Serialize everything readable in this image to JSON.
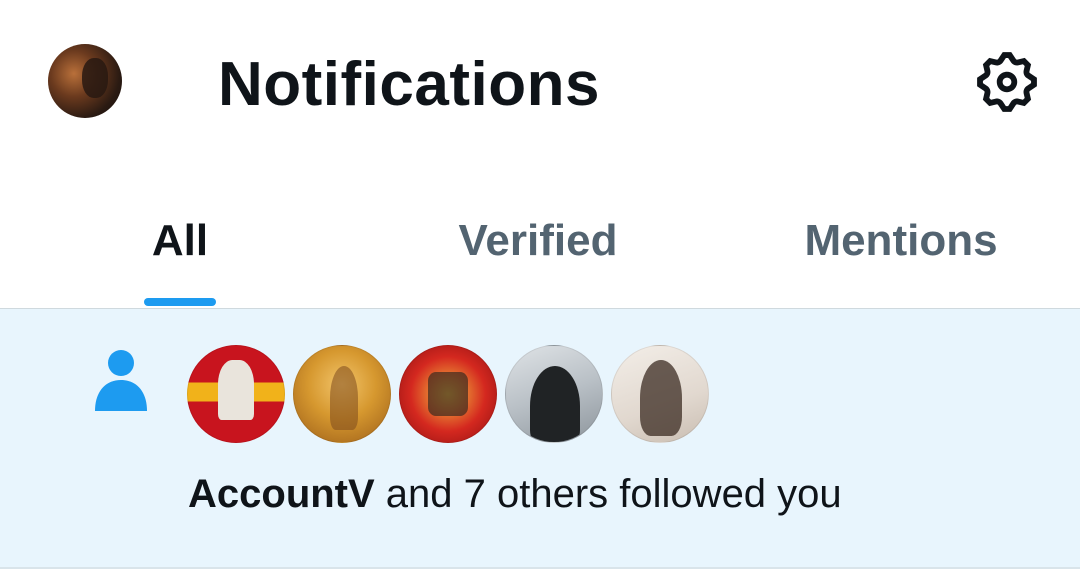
{
  "header": {
    "title": "Notifications",
    "profile_avatar_icon": "profile-avatar",
    "settings_icon": "gear-icon"
  },
  "tabs": [
    {
      "label": "All",
      "selected": true
    },
    {
      "label": "Verified",
      "selected": false
    },
    {
      "label": "Mentions",
      "selected": false
    }
  ],
  "notification": {
    "type_icon": "person-icon",
    "actor_name": "AccountV",
    "rest_text": " and 7 others followed you",
    "avatar_count": 5
  },
  "colors": {
    "accent": "#1d9bf0",
    "unread_background": "#e8f5fd",
    "primary_text": "#0f1419",
    "secondary_text": "#536471"
  }
}
